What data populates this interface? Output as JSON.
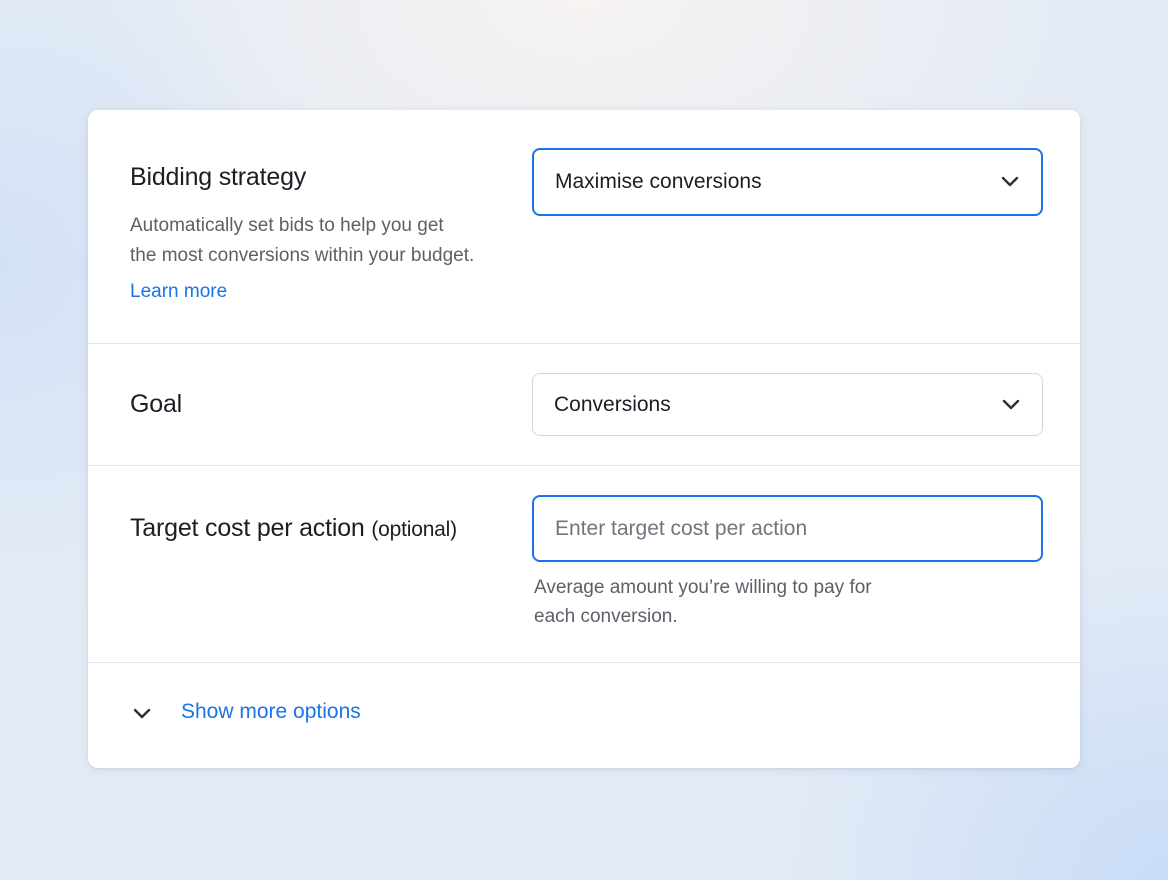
{
  "bidding": {
    "title": "Bidding strategy",
    "description_line1": "Automatically set bids to help you get",
    "description_line2": "the most conversions within your budget.",
    "learn_more": "Learn more",
    "selected": "Maximise conversions"
  },
  "goal": {
    "title": "Goal",
    "selected": "Conversions"
  },
  "target_cpa": {
    "title": "Target cost per action",
    "title_suffix": "(optional)",
    "value": "",
    "placeholder": "Enter target cost per action",
    "helper_line1": "Average amount you’re willing to pay for",
    "helper_line2": "each conversion."
  },
  "show_more": {
    "label": "Show more options",
    "icon": "chevron-down-icon"
  },
  "colors": {
    "accent": "#1a73e8",
    "text": "#1b1f25",
    "muted": "#5b6169",
    "divider": "#e3e6ea"
  }
}
